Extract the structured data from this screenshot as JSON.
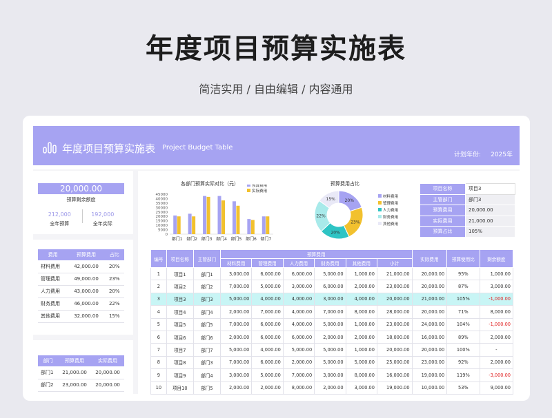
{
  "hero": {
    "title": "年度项目预算实施表",
    "subtitle": "简洁实用 / 自由编辑 / 内容通用"
  },
  "banner": {
    "title": "年度项目预算实施表",
    "subtitle_en": "Project Budget Table",
    "plan_label": "计划年份:",
    "plan_year": "2025年"
  },
  "summary": {
    "remaining_value": "20,000.00",
    "remaining_label": "预算剩余额度",
    "annual_budget": "212,000",
    "annual_budget_label": "全年预算",
    "annual_actual": "192,000",
    "annual_actual_label": "全年实际"
  },
  "expense_table": {
    "headers": [
      "费用",
      "预算费用",
      "占比"
    ],
    "rows": [
      [
        "材料费用",
        "42,000.00",
        "20%"
      ],
      [
        "管理费用",
        "49,000.00",
        "23%"
      ],
      [
        "人力费用",
        "43,000.00",
        "20%"
      ],
      [
        "财务费用",
        "46,000.00",
        "22%"
      ],
      [
        "其他费用",
        "32,000.00",
        "15%"
      ]
    ]
  },
  "dept_table": {
    "headers": [
      "部门",
      "预算费用",
      "实际费用"
    ],
    "rows": [
      [
        "部门1",
        "21,000.00",
        "20,000.00"
      ],
      [
        "部门2",
        "23,000.00",
        "20,000.00"
      ]
    ]
  },
  "bar_chart_title": "各部门预算实际对比（元）",
  "pie_chart_title": "预算费用占比",
  "chart_data": [
    {
      "type": "bar",
      "title": "各部门预算实际对比（元）",
      "categories": [
        "部门1",
        "部门2",
        "部门3",
        "部门4",
        "部门5",
        "部门6",
        "部门7"
      ],
      "series": [
        {
          "name": "预算费用",
          "color": "#a6a3f2",
          "values": [
            21000,
            23000,
            43000,
            43000,
            37000,
            17000,
            20000
          ]
        },
        {
          "name": "实际费用",
          "color": "#f2c12e",
          "values": [
            20000,
            20000,
            42000,
            38000,
            32000,
            16000,
            20000
          ]
        }
      ],
      "yticks": [
        "0",
        "5000",
        "10000",
        "15000",
        "20000",
        "25000",
        "30000",
        "35000",
        "40000",
        "45000"
      ],
      "ylim": [
        0,
        45000
      ]
    },
    {
      "type": "pie",
      "title": "预算费用占比",
      "labels": [
        "材料费用",
        "管理费用",
        "人力费用",
        "财务费用",
        "其他费用"
      ],
      "values": [
        20,
        23,
        20,
        22,
        15
      ],
      "value_labels": [
        "20%",
        "23%",
        "20%",
        "22%",
        "15%"
      ],
      "colors": [
        "#a6a3f2",
        "#f2c12e",
        "#2ec4c4",
        "#a8eaea",
        "#e9e9f7"
      ]
    }
  ],
  "info": {
    "rows": [
      [
        "项目名称",
        "项目3"
      ],
      [
        "主管部门",
        "部门3"
      ],
      [
        "预算费用",
        "20,000.00"
      ],
      [
        "实际费用",
        "21,000.00"
      ],
      [
        "预算占比",
        "105%"
      ]
    ]
  },
  "main_table": {
    "headers_top": [
      "编号",
      "项目名称",
      "主管部门",
      "预算费用",
      "实际费用",
      "预算使用比",
      "剩余额度"
    ],
    "headers_sub": [
      "材料费用",
      "管理费用",
      "人力费用",
      "财务费用",
      "其他费用",
      "小计"
    ],
    "rows": [
      [
        "1",
        "项目1",
        "部门1",
        "3,000.00",
        "6,000.00",
        "6,000.00",
        "5,000.00",
        "1,000.00",
        "21,000.00",
        "20,000.00",
        "95%",
        "1,000.00"
      ],
      [
        "2",
        "项目2",
        "部门2",
        "7,000.00",
        "5,000.00",
        "3,000.00",
        "6,000.00",
        "2,000.00",
        "23,000.00",
        "20,000.00",
        "87%",
        "3,000.00"
      ],
      [
        "3",
        "项目3",
        "部门3",
        "5,000.00",
        "4,000.00",
        "4,000.00",
        "3,000.00",
        "4,000.00",
        "20,000.00",
        "21,000.00",
        "105%",
        "-1,000.00"
      ],
      [
        "4",
        "项目4",
        "部门4",
        "2,000.00",
        "7,000.00",
        "4,000.00",
        "7,000.00",
        "8,000.00",
        "28,000.00",
        "20,000.00",
        "71%",
        "8,000.00"
      ],
      [
        "5",
        "项目5",
        "部门5",
        "7,000.00",
        "6,000.00",
        "4,000.00",
        "5,000.00",
        "1,000.00",
        "23,000.00",
        "24,000.00",
        "104%",
        "-1,000.00"
      ],
      [
        "6",
        "项目6",
        "部门6",
        "2,000.00",
        "6,000.00",
        "6,000.00",
        "2,000.00",
        "2,000.00",
        "18,000.00",
        "16,000.00",
        "89%",
        "2,000.00"
      ],
      [
        "7",
        "项目7",
        "部门7",
        "5,000.00",
        "4,000.00",
        "5,000.00",
        "5,000.00",
        "1,000.00",
        "20,000.00",
        "20,000.00",
        "100%",
        "-"
      ],
      [
        "8",
        "项目8",
        "部门3",
        "7,000.00",
        "6,000.00",
        "2,000.00",
        "5,000.00",
        "5,000.00",
        "25,000.00",
        "23,000.00",
        "92%",
        "2,000.00"
      ],
      [
        "9",
        "项目9",
        "部门4",
        "3,000.00",
        "5,000.00",
        "7,000.00",
        "3,000.00",
        "8,000.00",
        "16,000.00",
        "19,000.00",
        "119%",
        "-3,000.00"
      ],
      [
        "10",
        "项目10",
        "部门5",
        "2,000.00",
        "2,000.00",
        "8,000.00",
        "2,000.00",
        "3,000.00",
        "19,000.00",
        "10,000.00",
        "53%",
        "9,000.00"
      ]
    ],
    "highlight_row": 2
  }
}
